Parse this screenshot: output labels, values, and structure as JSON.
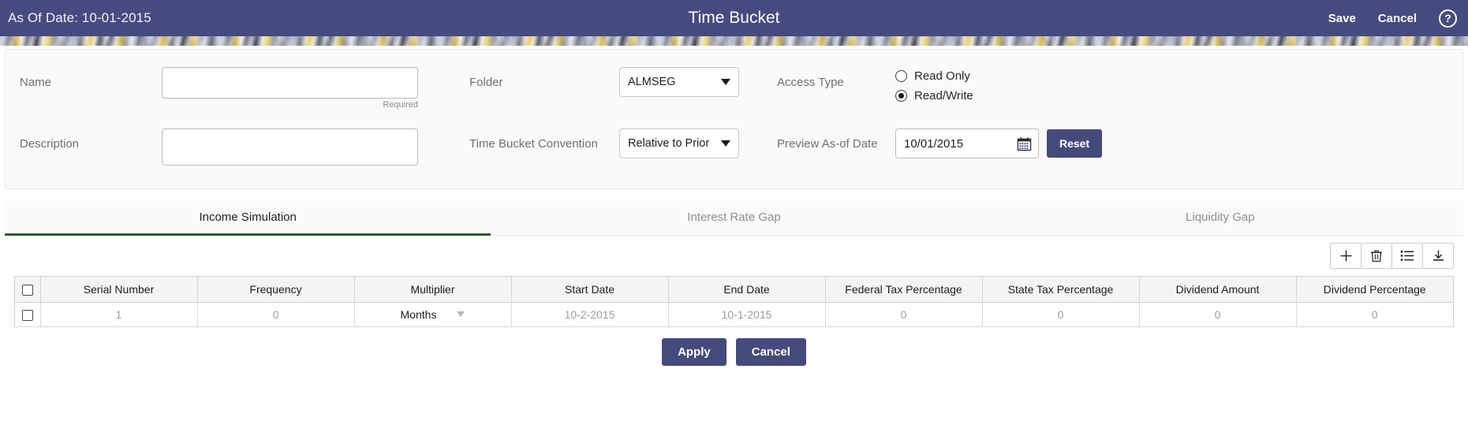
{
  "header": {
    "as_of_date_label": "As Of Date: 10-01-2015",
    "title": "Time Bucket",
    "save_label": "Save",
    "cancel_label": "Cancel",
    "help_glyph": "?",
    "bg_color": "#464b7f"
  },
  "form": {
    "name_label": "Name",
    "name_value": "",
    "name_required_note": "Required",
    "description_label": "Description",
    "description_value": "",
    "folder_label": "Folder",
    "folder_value": "ALMSEG",
    "convention_label": "Time Bucket Convention",
    "convention_value": "Relative to Prior",
    "access_type_label": "Access Type",
    "access_read_only_label": "Read Only",
    "access_read_write_label": "Read/Write",
    "access_selected": "Read/Write",
    "preview_date_label": "Preview As-of Date",
    "preview_date_value": "10/01/2015",
    "reset_label": "Reset"
  },
  "tabs": [
    {
      "label": "Income Simulation",
      "active": true
    },
    {
      "label": "Interest Rate Gap",
      "active": false
    },
    {
      "label": "Liquidity Gap",
      "active": false
    }
  ],
  "toolbar": {
    "add_icon": "plus-icon",
    "delete_icon": "trash-icon",
    "list_icon": "list-icon",
    "download_icon": "download-icon"
  },
  "table": {
    "columns": [
      "Serial Number",
      "Frequency",
      "Multiplier",
      "Start Date",
      "End Date",
      "Federal Tax Percentage",
      "State Tax Percentage",
      "Dividend Amount",
      "Dividend Percentage"
    ],
    "rows": [
      {
        "serial_number": "1",
        "frequency": "0",
        "multiplier": "Months",
        "start_date": "10-2-2015",
        "end_date": "10-1-2015",
        "federal_tax_percentage": "0",
        "state_tax_percentage": "0",
        "dividend_amount": "0",
        "dividend_percentage": "0"
      }
    ]
  },
  "footer": {
    "apply_label": "Apply",
    "cancel_label": "Cancel"
  },
  "theme": {
    "accent": "#454a7d",
    "tab_active_underline": "#2f5c33"
  }
}
